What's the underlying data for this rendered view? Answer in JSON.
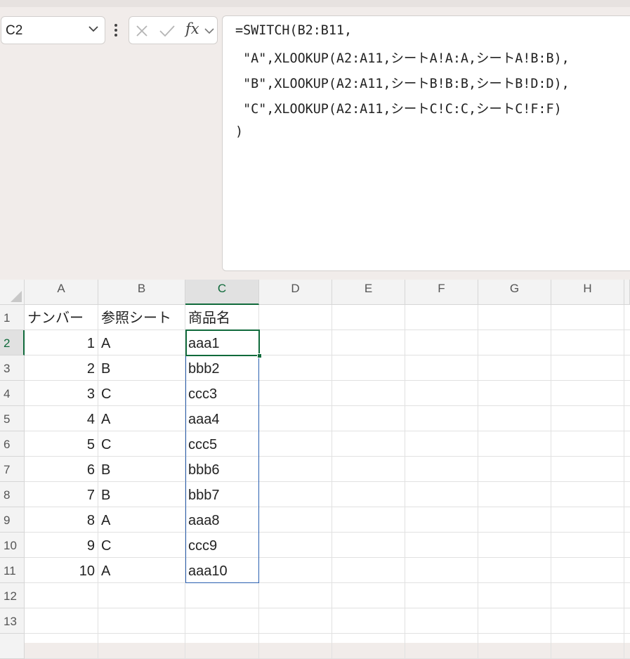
{
  "name_box": {
    "value": "C2"
  },
  "formula_bar": {
    "lines": [
      "=SWITCH(B2:B11,",
      " \"A\",XLOOKUP(A2:A11,シートA!A:A,シートA!B:B),",
      " \"B\",XLOOKUP(A2:A11,シートB!B:B,シートB!D:D),",
      " \"C\",XLOOKUP(A2:A11,シートC!C:C,シートC!F:F)",
      ")"
    ]
  },
  "columns": [
    "A",
    "B",
    "C",
    "D",
    "E",
    "F",
    "G",
    "H"
  ],
  "rows": [
    "1",
    "2",
    "3",
    "4",
    "5",
    "6",
    "7",
    "8",
    "9",
    "10",
    "11",
    "12",
    "13"
  ],
  "cells": {
    "A": [
      "ナンバー",
      "1",
      "2",
      "3",
      "4",
      "5",
      "6",
      "7",
      "8",
      "9",
      "10"
    ],
    "B": [
      "参照シート",
      "A",
      "B",
      "C",
      "A",
      "C",
      "B",
      "B",
      "A",
      "C",
      "A"
    ],
    "C": [
      "商品名",
      "aaa1",
      "bbb2",
      "ccc3",
      "aaa4",
      "ccc5",
      "bbb6",
      "bbb7",
      "aaa8",
      "ccc9",
      "aaa10"
    ]
  },
  "selection": {
    "active_cell": "C2",
    "range": "C2:C11"
  },
  "colors": {
    "selection_green": "#106a3b",
    "spill_blue": "#2a5fb0"
  }
}
